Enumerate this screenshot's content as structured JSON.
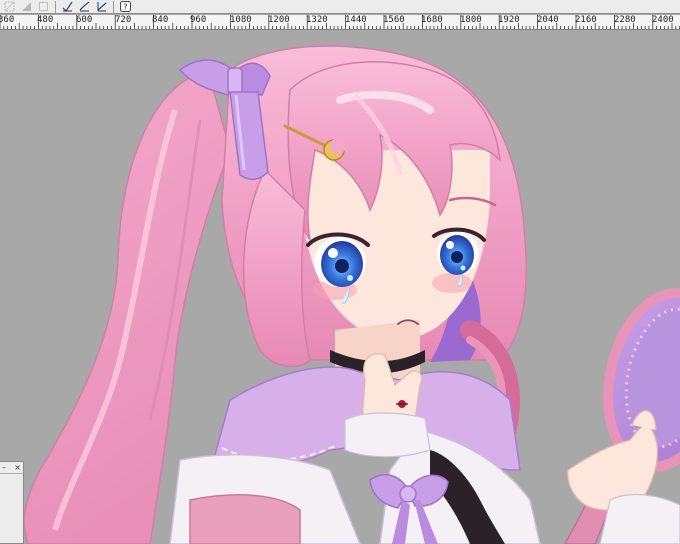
{
  "toolbar": {
    "buttons": [
      {
        "icon": "select-disabled-icon"
      },
      {
        "icon": "fill-disabled-icon"
      },
      {
        "icon": "frame-disabled-icon"
      },
      {
        "icon": "line-tool-1-icon"
      },
      {
        "icon": "line-tool-2-icon"
      },
      {
        "icon": "line-tool-3-icon"
      },
      {
        "icon": "help-icon"
      }
    ]
  },
  "ruler": {
    "labels": [
      "360",
      "480",
      "600",
      "720",
      "840",
      "960",
      "1080",
      "1200",
      "1320",
      "1440",
      "1560",
      "1680",
      "1800",
      "1920",
      "2040",
      "2160",
      "2280",
      "2400"
    ]
  },
  "mini_panel": {
    "minimize_glyph": "–",
    "close_glyph": "×"
  },
  "colors": {
    "canvas_bg": "#a8a8a8",
    "hair_pink": "#f2a7c6",
    "hair_shadow": "#d97fa9",
    "ribbon_purple": "#c89ee8",
    "eye_blue": "#2f5fd6",
    "skin": "#fde6dc",
    "collar_lilac": "#d7b0ea",
    "blouse_white": "#f4f0f6"
  }
}
